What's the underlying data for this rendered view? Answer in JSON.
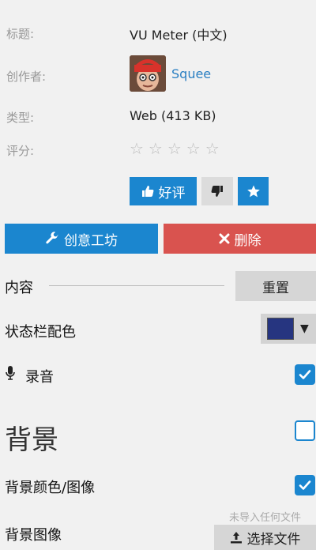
{
  "info": {
    "title_label": "标题:",
    "title_value": "VU Meter (中文)",
    "author_label": "创作者:",
    "author_name": "Squee",
    "type_label": "类型:",
    "type_value": "Web (413 KB)",
    "rating_label": "评分:",
    "rating_stars": "☆☆☆☆☆",
    "rating_value": 0
  },
  "rating_buttons": {
    "like_label": "好评",
    "dislike_icon": "thumbs-down-icon",
    "favorite_icon": "star-icon"
  },
  "actions": {
    "workshop_label": "创意工坊",
    "delete_label": "删除"
  },
  "settings": {
    "content_label": "内容",
    "reset_label": "重置",
    "statusbar_color_label": "状态栏配色",
    "statusbar_color": "#263580",
    "record_label": "录音",
    "record_checked": true,
    "background_title": "背景",
    "background_checked": false,
    "bg_color_image_label": "背景颜色/图像",
    "bg_color_image_checked": true,
    "bg_image_label": "背景图像",
    "no_file_text": "未导入任何文件",
    "choose_file_label": "选择文件"
  },
  "colors": {
    "accent": "#1b86cf",
    "danger": "#d9534f",
    "background": "#f1f1f1"
  }
}
